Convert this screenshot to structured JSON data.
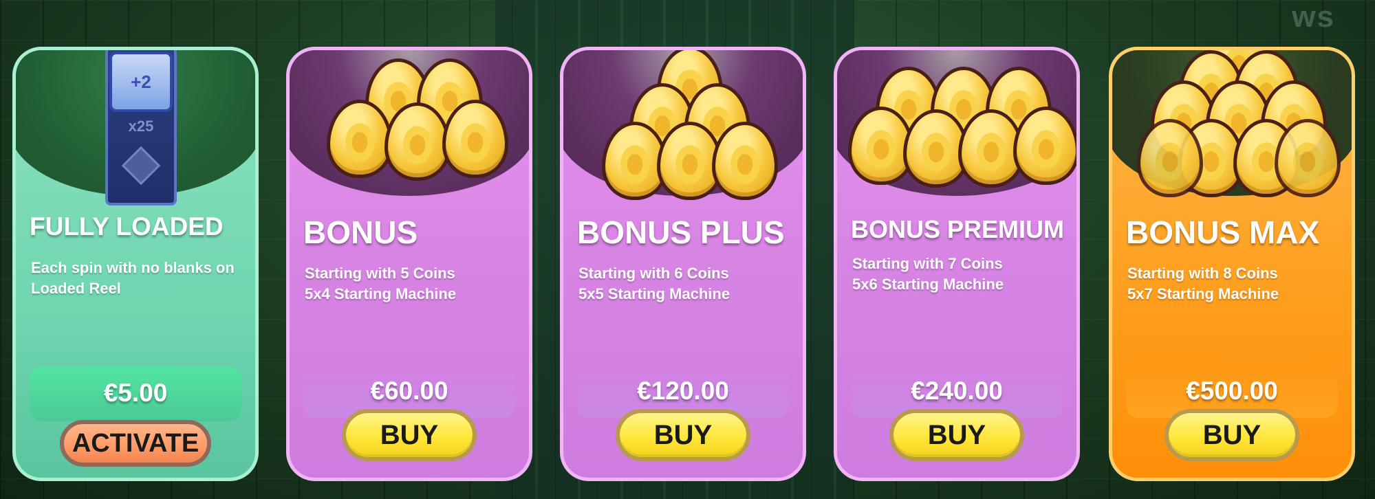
{
  "background": {
    "corner_text": "ws"
  },
  "cards": [
    {
      "id": "fully-loaded",
      "title": "FULLY LOADED",
      "description_lines": [
        "Each spin with no blanks on",
        "Loaded Reel"
      ],
      "price": "€5.00",
      "button_label": "ACTIVATE",
      "theme": "green",
      "reel": {
        "top_symbol": "+2",
        "multiplier": "x25"
      }
    },
    {
      "id": "bonus",
      "title": "BONUS",
      "description_lines": [
        "Starting with 5 Coins",
        "5x4 Starting Machine"
      ],
      "price": "€60.00",
      "button_label": "BUY",
      "theme": "purple",
      "coins": 5
    },
    {
      "id": "bonus-plus",
      "title": "BONUS PLUS",
      "description_lines": [
        "Starting with 6 Coins",
        "5x5 Starting Machine"
      ],
      "price": "€120.00",
      "button_label": "BUY",
      "theme": "purple",
      "coins": 6
    },
    {
      "id": "bonus-premium",
      "title": "BONUS PREMIUM",
      "description_lines": [
        "Starting with 7 Coins",
        "5x6 Starting Machine"
      ],
      "price": "€240.00",
      "button_label": "BUY",
      "theme": "purple",
      "coins": 7
    },
    {
      "id": "bonus-max",
      "title": "BONUS MAX",
      "description_lines": [
        "Starting with 8 Coins",
        "5x7 Starting Machine"
      ],
      "price": "€500.00",
      "button_label": "BUY",
      "theme": "orange",
      "coins": 10
    }
  ],
  "colors": {
    "green_card": "#6fd6b0",
    "purple_card": "#d784e4",
    "orange_card": "#ff9f1f",
    "buy_button": "#ffe63a",
    "activate_button": "#ff9a66"
  }
}
